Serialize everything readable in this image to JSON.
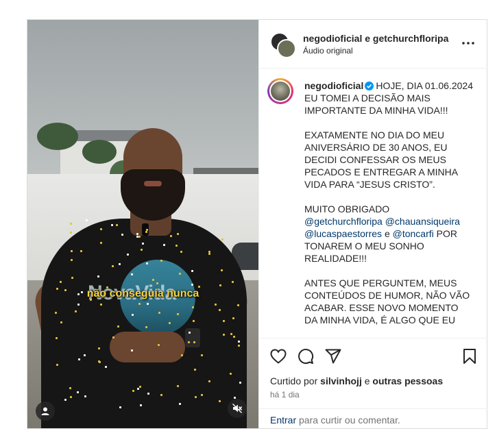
{
  "header": {
    "names": "negodioficial e getchurchfloripa",
    "audio": "Áudio original"
  },
  "video": {
    "caption_overlay": "não conseguia nunca",
    "shirt_text": "NovaVida"
  },
  "caption": {
    "username": "negodioficial",
    "verified": true,
    "lines": {
      "p1": "HOJE, DIA 01.06.2024 EU TOMEI A DECISÃO MAIS IMPORTANTE DA MINHA VIDA!!!",
      "p2": "EXATAMENTE NO DIA DO MEU ANIVERSÁRIO DE 30 ANOS, EU DECIDI CONFESSAR OS MEUS PECADOS E ENTREGAR A MINHA VIDA PARA “JESUS CRISTO”.",
      "p3_intro": "MUITO OBRIGADO",
      "mention1": "@getchurchfloripa",
      "mention2": "@chauansiqueira",
      "mention3": "@lucaspaestorres",
      "and": "e",
      "mention4": "@toncarfi",
      "p3_end": "POR TONAREM O MEU SONHO REALIDADE!!!",
      "p4": "ANTES QUE PERGUNTEM, MEUS CONTEÚDOS DE HUMOR, NÃO VÃO ACABAR. ESSE NOVO MOMENTO DA MINHA VIDA, É ALGO QUE EU"
    }
  },
  "actions": {
    "liked_prefix": "Curtido por",
    "liked_user": "silvinhojj",
    "liked_and": "e",
    "liked_others": "outras pessoas",
    "time": "há 1 dia"
  },
  "comment": {
    "login": "Entrar",
    "hint": "para curtir ou comentar."
  },
  "colors": {
    "link": "#00376b",
    "caption_overlay": "#f7d43a",
    "verified": "#0095f6"
  },
  "icons": [
    "more-icon",
    "user-icon",
    "mute-icon",
    "heart-icon",
    "comment-icon",
    "share-icon",
    "bookmark-icon",
    "verified-badge-icon"
  ]
}
